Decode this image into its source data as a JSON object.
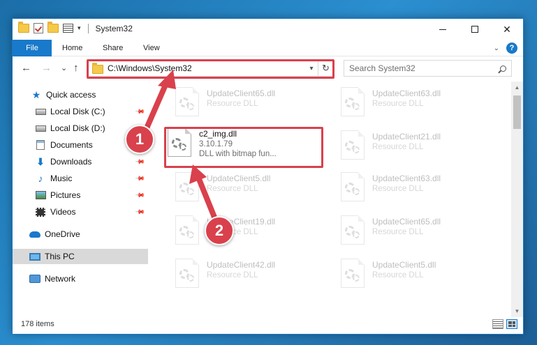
{
  "window": {
    "title": "System32",
    "controls": {
      "minimize": "minimize",
      "maximize": "maximize",
      "close": "✕"
    }
  },
  "ribbon": {
    "tabs": [
      {
        "label": "File"
      },
      {
        "label": "Home"
      },
      {
        "label": "Share"
      },
      {
        "label": "View"
      }
    ],
    "help": "?"
  },
  "nav": {
    "back": "←",
    "forward": "→",
    "recent": "⌄",
    "up": "↑",
    "address": "C:\\Windows\\System32",
    "refresh": "↻"
  },
  "search": {
    "placeholder": "Search System32"
  },
  "sidebar": {
    "items": [
      {
        "label": "Quick access",
        "icon": "star-icon",
        "pinned": false
      },
      {
        "label": "Local Disk (C:)",
        "icon": "drive-icon",
        "pinned": true
      },
      {
        "label": "Local Disk (D:)",
        "icon": "drive-icon",
        "pinned": false
      },
      {
        "label": "Documents",
        "icon": "document-icon",
        "pinned": true
      },
      {
        "label": "Downloads",
        "icon": "download-icon",
        "pinned": true
      },
      {
        "label": "Music",
        "icon": "music-icon",
        "pinned": true
      },
      {
        "label": "Pictures",
        "icon": "pictures-icon",
        "pinned": true
      },
      {
        "label": "Videos",
        "icon": "videos-icon",
        "pinned": true
      },
      {
        "label": "OneDrive",
        "icon": "onedrive-icon",
        "pinned": false
      },
      {
        "label": "This PC",
        "icon": "this-pc-icon",
        "pinned": false,
        "selected": true
      },
      {
        "label": "Network",
        "icon": "network-icon",
        "pinned": false
      }
    ]
  },
  "files": {
    "highlighted": {
      "name": "c2_img.dll",
      "version": "3.10.1.79",
      "description": "DLL with bitmap fun..."
    },
    "left_column": [
      {
        "name": "UpdateClient65.dll",
        "sub": "Resource DLL"
      },
      {
        "name": "UpdateClient5.dll",
        "sub": "Resource DLL"
      },
      {
        "name": "UpdateClient19.dll",
        "sub": "Resource DLL"
      },
      {
        "name": "UpdateClient42.dll",
        "sub": "Resource DLL"
      }
    ],
    "right_column": [
      {
        "name": "UpdateClient63.dll",
        "sub": "Resource DLL"
      },
      {
        "name": "UpdateClient21.dll",
        "sub": "Resource DLL"
      },
      {
        "name": "UpdateClient63.dll",
        "sub": "Resource DLL"
      },
      {
        "name": "UpdateClient65.dll",
        "sub": "Resource DLL"
      },
      {
        "name": "UpdateClient5.dll",
        "sub": "Resource DLL"
      }
    ]
  },
  "status": {
    "item_count": "178 items"
  },
  "annotations": {
    "step1": "1",
    "step2": "2",
    "color": "#d9414c"
  }
}
